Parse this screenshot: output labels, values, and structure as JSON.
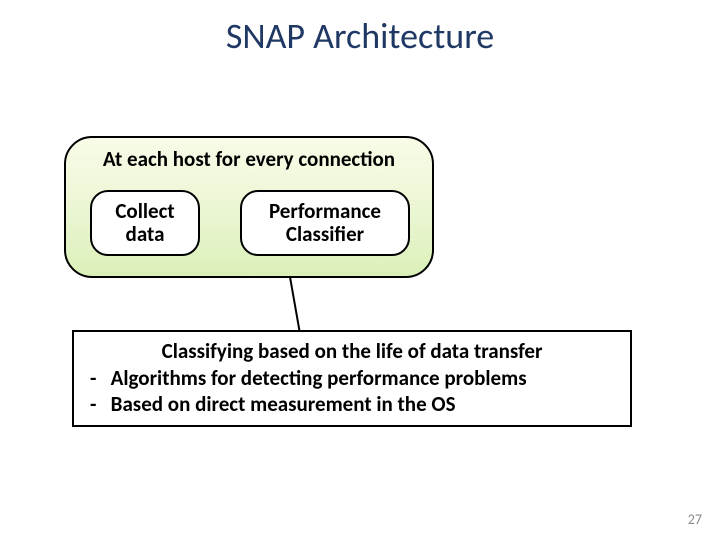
{
  "title": "SNAP Architecture",
  "host_box": {
    "label": "At each host for every connection",
    "collect_label": "Collect\ndata",
    "perf_label": "Performance\nClassifier"
  },
  "description": {
    "heading": "Classifying based on the life of data transfer",
    "bullets": [
      "Algorithms for detecting performance problems",
      "Based on direct measurement in the OS"
    ]
  },
  "page_number": "27"
}
